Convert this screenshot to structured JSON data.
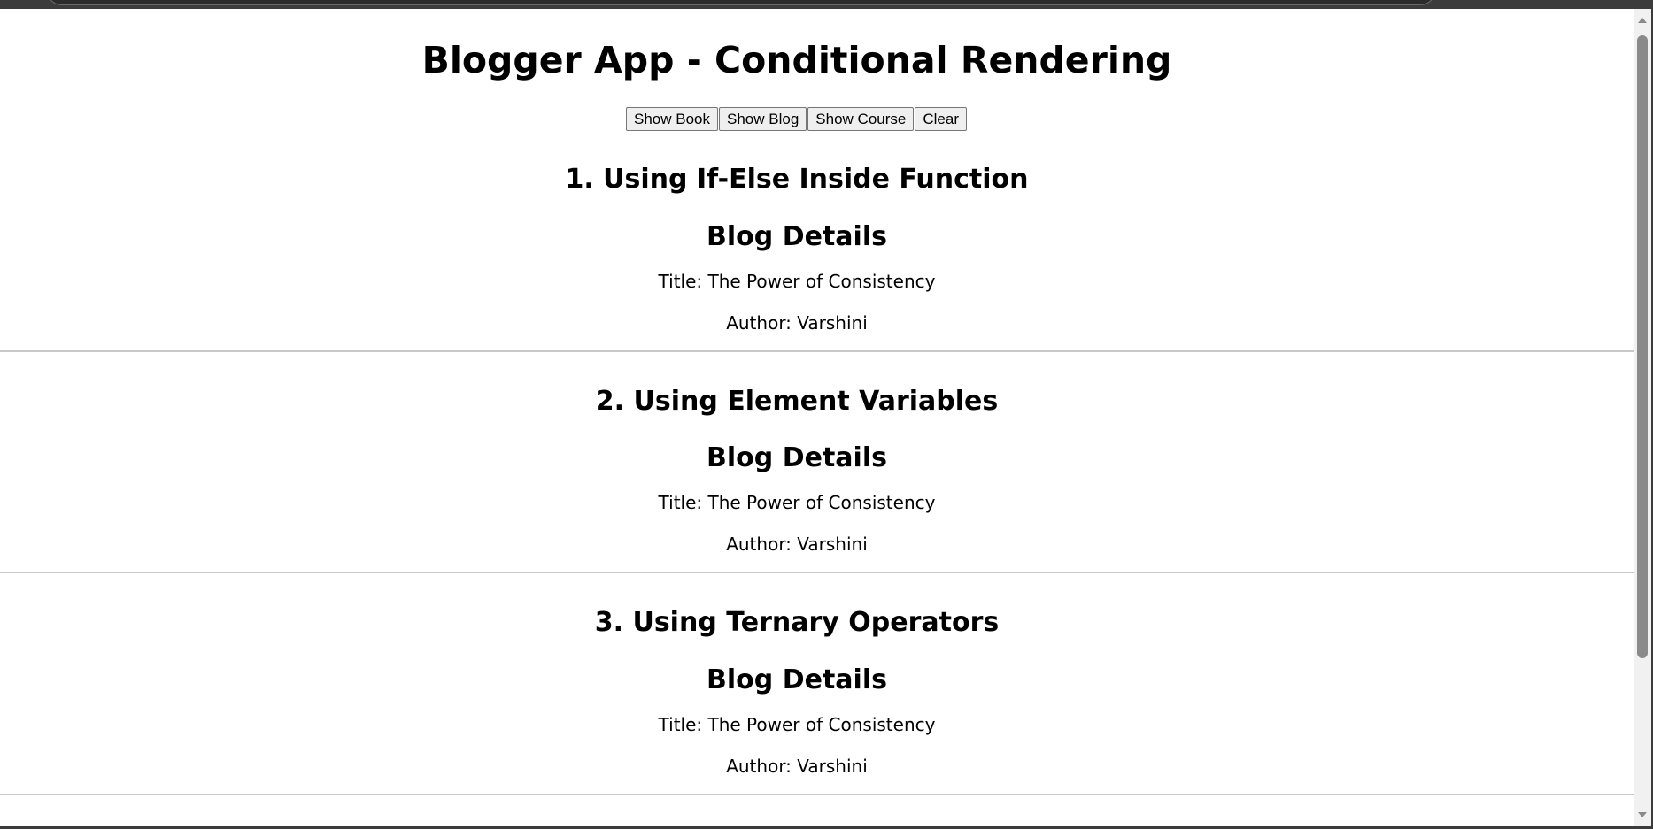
{
  "page": {
    "title": "Blogger App - Conditional Rendering"
  },
  "buttons": {
    "show_book": "Show Book",
    "show_blog": "Show Blog",
    "show_course": "Show Course",
    "clear": "Clear"
  },
  "sections": [
    {
      "heading": "1. Using If-Else Inside Function",
      "details_heading": "Blog Details",
      "title_line": "Title: The Power of Consistency",
      "author_line": "Author: Varshini"
    },
    {
      "heading": "2. Using Element Variables",
      "details_heading": "Blog Details",
      "title_line": "Title: The Power of Consistency",
      "author_line": "Author: Varshini"
    },
    {
      "heading": "3. Using Ternary Operators",
      "details_heading": "Blog Details",
      "title_line": "Title: The Power of Consistency",
      "author_line": "Author: Varshini"
    }
  ]
}
